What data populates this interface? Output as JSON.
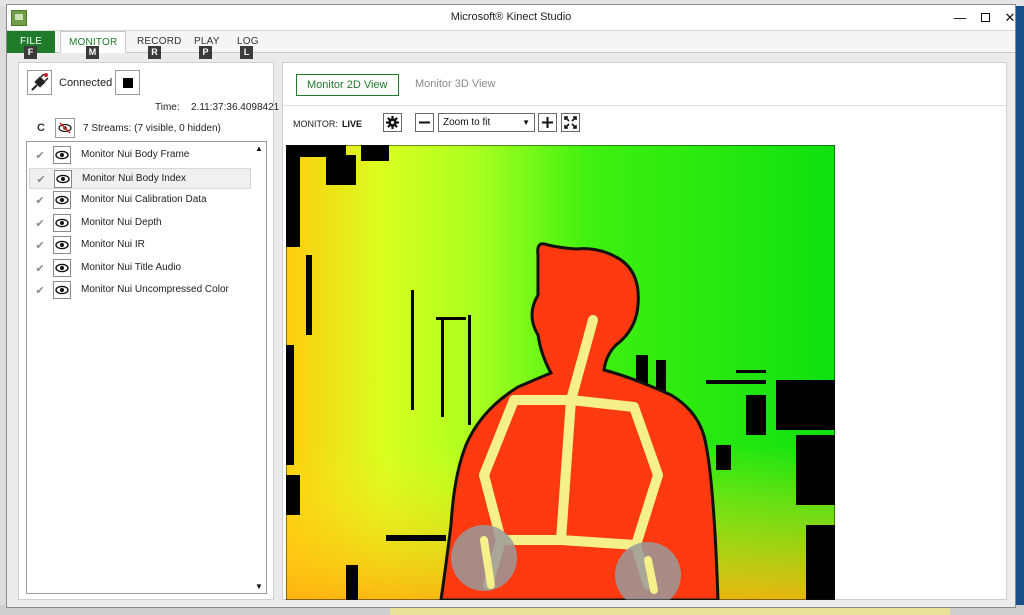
{
  "window": {
    "title": "Microsoft® Kinect Studio",
    "min_glyph": "—",
    "close_glyph": "✕"
  },
  "menu": {
    "tabs": [
      {
        "label": "FILE",
        "keytip": "F"
      },
      {
        "label": "MONITOR",
        "keytip": "M"
      },
      {
        "label": "RECORD",
        "keytip": "R"
      },
      {
        "label": "PLAY",
        "keytip": "P"
      },
      {
        "label": "LOG",
        "keytip": "L"
      }
    ]
  },
  "connection": {
    "status": "Connected",
    "time_label": "Time:",
    "time_value": "2.11:37:36.4098421"
  },
  "streams": {
    "clear_label": "C",
    "summary": "7 Streams: (7 visible, 0 hidden)",
    "items": [
      {
        "label": "Monitor Nui Body Frame"
      },
      {
        "label": "Monitor Nui Body Index"
      },
      {
        "label": "Monitor Nui Calibration Data"
      },
      {
        "label": "Monitor Nui Depth"
      },
      {
        "label": "Monitor Nui IR"
      },
      {
        "label": "Monitor Nui Title Audio"
      },
      {
        "label": "Monitor Nui Uncompressed Color"
      }
    ],
    "selected_index": 1
  },
  "viewer": {
    "tabs": [
      "Monitor 2D View",
      "Monitor 3D View"
    ],
    "active_tab": "Monitor 2D View",
    "monitor_label": "MONITOR:",
    "monitor_state": "LIVE",
    "zoom_value": "Zoom to fit"
  },
  "colors": {
    "accent": "#1f7a2a",
    "depth_near": "#ff3a10",
    "depth_mid": "#ffff20",
    "depth_far": "#00e000",
    "skeleton": "#f5f08a"
  }
}
